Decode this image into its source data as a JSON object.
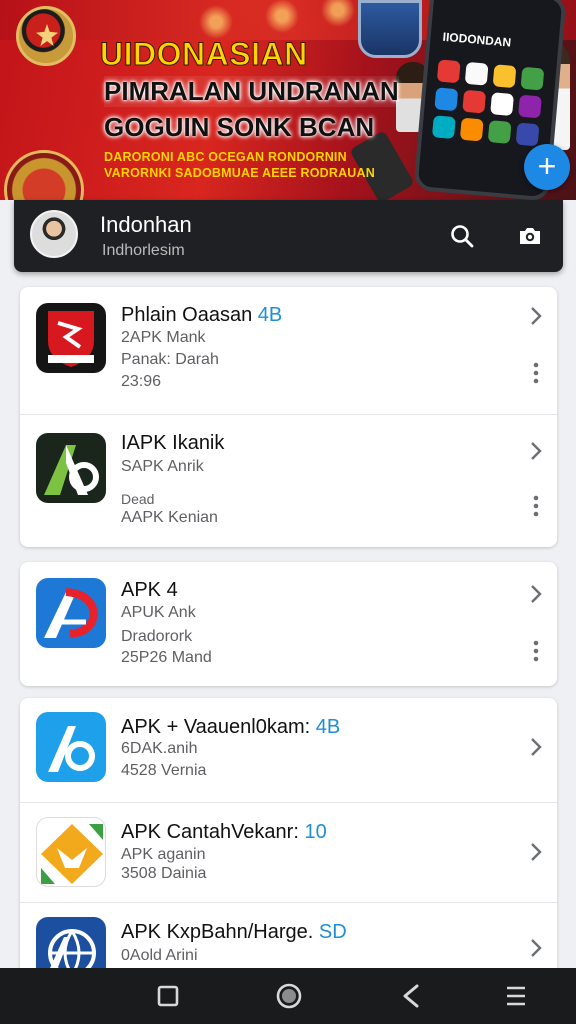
{
  "banner": {
    "title": "UIDONASIAN",
    "line2": "PIMRALAN UNDRANAN",
    "line3": "GOGUIN SONK BCAN",
    "small1": "DARORONI ABC OCEGAN RONDORNIN",
    "small2": "VARORNKI SADOBMUAE AEEE RODRAUAN",
    "phone_text": "IIODONDAN",
    "fab_icon": "plus-icon",
    "fab_label": "+"
  },
  "header": {
    "title": "Indonhan",
    "subtitle": "Indhorlesim",
    "icons": [
      "search-icon",
      "camera-icon"
    ]
  },
  "apps": [
    {
      "title": "Phlain Oaasan",
      "tag": "4B",
      "line1": "2APK Mank",
      "line2": "Panak: Darah",
      "line3": "23:96",
      "icon": "shield-app-icon",
      "color": "#d7191f"
    },
    {
      "title": "IAPK Ikanik",
      "tag": "",
      "line1": "SAPK Anrik",
      "line2": "Dead",
      "line3": "AAPK Kenian",
      "icon": "apk-a-dark-icon",
      "color": "#1c2b1e"
    },
    {
      "title": "APK 4",
      "tag": "",
      "line1": "APUK Ank",
      "line2": "Dradorork",
      "line3": "25P26 Mand",
      "icon": "apk-a-blue-red-icon",
      "color": "#1e78d6"
    },
    {
      "title": "APK + Vaauenl0kam:",
      "tag": "4B",
      "line1": "6DAK.anih",
      "line2": "4528 Vernia",
      "icon": "apk-b-blue-icon",
      "color": "#1ea0ea"
    },
    {
      "title": "APK CantahVekanr:",
      "tag": "10",
      "line1": "APK aganin",
      "line2": "3508 Dainia",
      "icon": "apk-fox-icon",
      "color": "#f2a91c"
    },
    {
      "title": "APK KxpBahn/Harge.",
      "tag": "SD",
      "line1": "0Aold Arini",
      "icon": "apk-globe-icon",
      "color": "#1d4fa0"
    }
  ],
  "navbar": {
    "icons": [
      "recent-apps-icon",
      "home-icon",
      "back-icon",
      "menu-icon"
    ]
  }
}
